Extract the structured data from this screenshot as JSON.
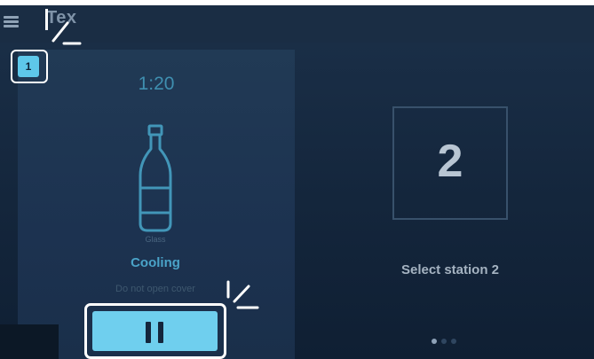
{
  "header": {
    "app_title": "Tex"
  },
  "station1": {
    "badge": "1",
    "timer": "1:20",
    "bottle_label": "Glass",
    "status": "Cooling",
    "warning": "Do not open cover",
    "bottle_icon": "bottle-icon",
    "pause_icon": "pause-icon"
  },
  "station2": {
    "number": "2",
    "label": "Select station 2"
  },
  "pagination": {
    "total_pages": 3,
    "active_page": 1
  },
  "colors": {
    "accent": "#6fcfee",
    "accent_text": "#4aa3c8",
    "background": "#14263c",
    "highlight": "#ffffff"
  }
}
